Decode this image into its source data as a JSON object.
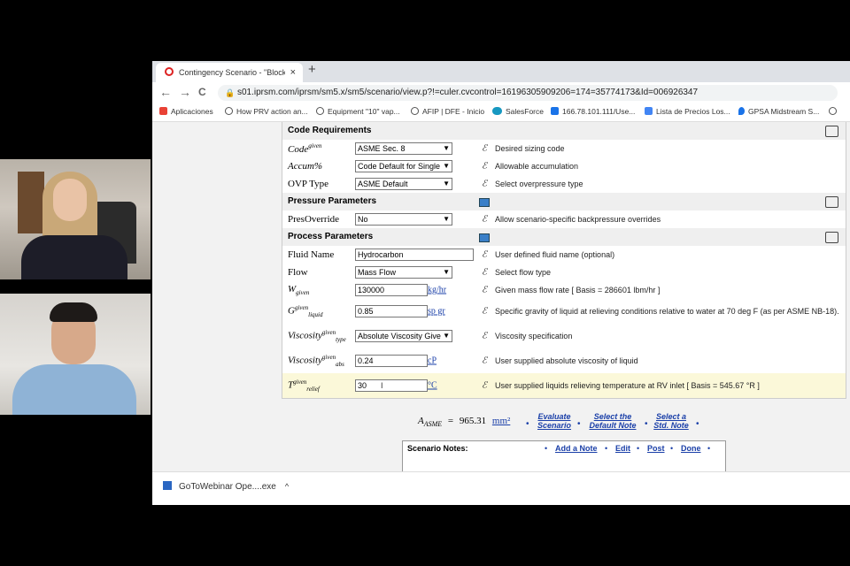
{
  "tab": {
    "title": "Contingency Scenario - \"Blocked",
    "close": "×",
    "new": "+"
  },
  "nav": {
    "back": "←",
    "forward": "→",
    "reload": "C",
    "url": "s01.iprsm.com/iprsm/sm5.x/sm5/scenario/view.p?!=culer.cvcontrol=16196305909206=174=35774173&Id=006926347"
  },
  "bookmarks": [
    {
      "label": "Aplicaciones",
      "icon": "apps-icon",
      "color": "#e94235"
    },
    {
      "label": "How PRV action an...",
      "icon": "globe-icon",
      "color": "#555555"
    },
    {
      "label": "Equipment \"10\" vap...",
      "icon": "globe-icon",
      "color": "#555555"
    },
    {
      "label": "AFIP | DFE - Inicio",
      "icon": "globe-icon",
      "color": "#555555"
    },
    {
      "label": "SalesForce",
      "icon": "cloud-icon",
      "color": "#1798c1"
    },
    {
      "label": "166.78.101.111/Use...",
      "icon": "g-icon",
      "color": "#1a73e8"
    },
    {
      "label": "Lista de Precios Los...",
      "icon": "doc-icon",
      "color": "#4285f4"
    },
    {
      "label": "GPSA Midstream S...",
      "icon": "drop-icon",
      "color": "#1a73e8"
    }
  ],
  "sections": {
    "code": "Code Requirements",
    "pressure": "Pressure Parameters",
    "process": "Process Parameters"
  },
  "rows": {
    "code": {
      "base": "Code",
      "sup": "given",
      "value": "ASME Sec. 8",
      "desc": "Desired sizing code"
    },
    "accum": {
      "label": "Accum%",
      "value": "Code Default for Single",
      "desc": "Allowable accumulation"
    },
    "ovp": {
      "label": "OVP Type",
      "value": "ASME Default",
      "desc": "Select overpressure type"
    },
    "presoverride": {
      "label": "PresOverride",
      "value": "No",
      "desc": "Allow scenario-specific backpressure overrides"
    },
    "fluid": {
      "label": "Fluid Name",
      "value": "Hydrocarbon",
      "desc": "User defined fluid name (optional)"
    },
    "flow": {
      "label": "Flow",
      "value": "Mass Flow",
      "desc": "Select flow type"
    },
    "w": {
      "base": "W",
      "sub": "given",
      "value": "130000",
      "unit": "kg/hr",
      "desc": "Given mass flow rate [ Basis = 286601 lbm/hr ]"
    },
    "g": {
      "base": "G",
      "sup": "given",
      "sub": "liquid",
      "value": "0.85",
      "unit": "sp gr",
      "desc": "Specific gravity of liquid at relieving conditions relative to water at 70 deg F (as per ASME NB-18)."
    },
    "visctype": {
      "base": "Viscosity",
      "sup": "given",
      "sub": "type",
      "value": "Absolute Viscosity Give",
      "desc": "Viscosity specification"
    },
    "viscabs": {
      "base": "Viscosity",
      "sup": "given",
      "sub": "abs",
      "value": "0.24",
      "unit": "cP",
      "desc": "User supplied absolute viscosity of liquid"
    },
    "trelief": {
      "base": "T",
      "sup": "given",
      "sub": "relief",
      "value": "30",
      "unit": "°C",
      "desc": "User supplied liquids relieving temperature at RV inlet [ Basis = 545.67 °R ]"
    }
  },
  "info_glyph": "ℰ",
  "result": {
    "symbol": "A",
    "sub": "ASME",
    "eq": "=",
    "value": "965.31",
    "unit": "mm²",
    "links": {
      "evaluate": "Evaluate Scenario",
      "default_note": "Select the Default Note",
      "std_note": "Select a Std. Note"
    }
  },
  "notes": {
    "title": "Scenario Notes:",
    "add": "Add a Note",
    "edit": "Edit",
    "post": "Post",
    "done": "Done"
  },
  "download": {
    "file": "GoToWebinar Ope....exe",
    "chevron": "^"
  },
  "cursor": "I"
}
